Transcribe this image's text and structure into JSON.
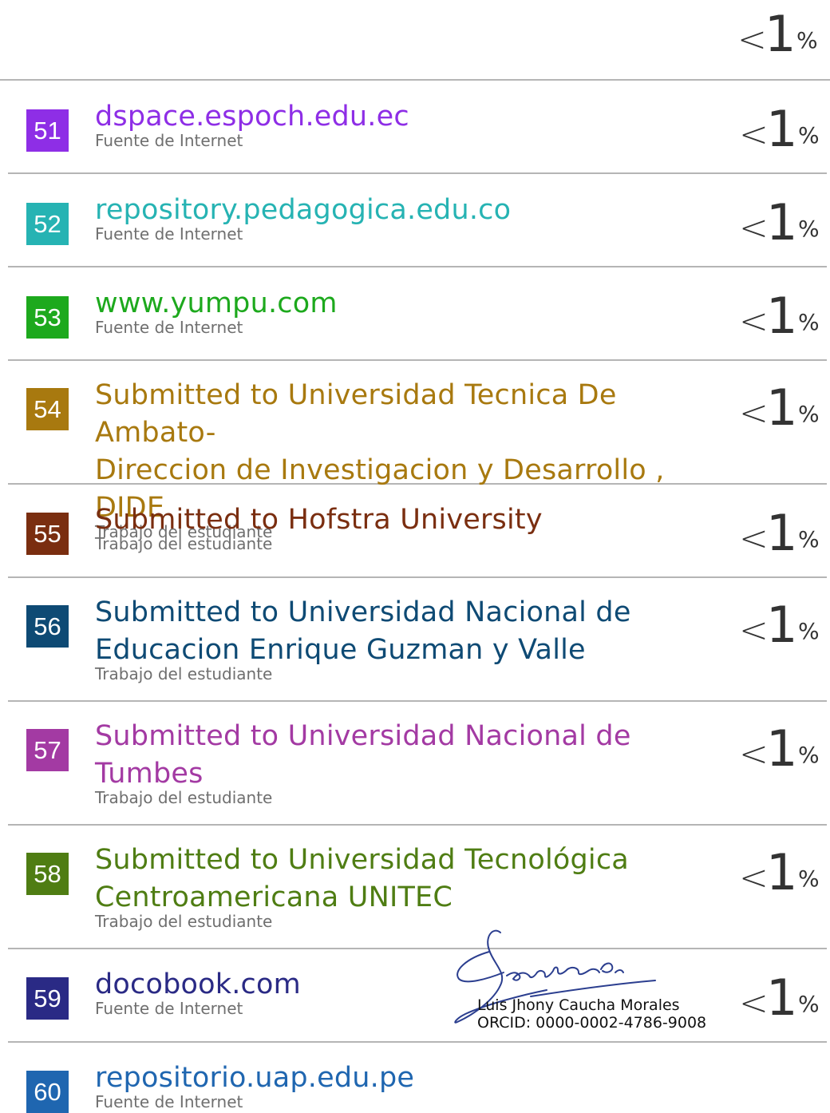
{
  "top_row": {
    "lt": "<",
    "one": "1",
    "percent": "%"
  },
  "sources": [
    {
      "index": "51",
      "title_lines": [
        "dspace.espoch.edu.ec"
      ],
      "type": "Fuente de Internet",
      "color": "#8e2ee6",
      "lt": "<",
      "one": "1",
      "percent": "%"
    },
    {
      "index": "52",
      "title_lines": [
        "repository.pedagogica.edu.co"
      ],
      "type": "Fuente de Internet",
      "color": "#26b3b3",
      "lt": "<",
      "one": "1",
      "percent": "%"
    },
    {
      "index": "53",
      "title_lines": [
        "www.yumpu.com"
      ],
      "type": "Fuente de Internet",
      "color": "#1da91d",
      "lt": "<",
      "one": "1",
      "percent": "%"
    },
    {
      "index": "54",
      "title_lines": [
        "Submitted to Universidad Tecnica De Ambato-",
        "Direccion de Investigacion y Desarrollo , DIDE"
      ],
      "type": "Trabajo del estudiante",
      "color": "#a8790f",
      "lt": "<",
      "one": "1",
      "percent": "%"
    },
    {
      "index": "55",
      "title_lines": [
        "Submitted to Hofstra University"
      ],
      "type": "Trabajo del estudiante",
      "color": "#7a2e10",
      "lt": "<",
      "one": "1",
      "percent": "%"
    },
    {
      "index": "56",
      "title_lines": [
        "Submitted to Universidad Nacional de",
        "Educacion Enrique Guzman y Valle"
      ],
      "type": "Trabajo del estudiante",
      "color": "#0e4a74",
      "lt": "<",
      "one": "1",
      "percent": "%"
    },
    {
      "index": "57",
      "title_lines": [
        "Submitted to Universidad Nacional de",
        "Tumbes"
      ],
      "type": "Trabajo del estudiante",
      "color": "#a33aa3",
      "lt": "<",
      "one": "1",
      "percent": "%"
    },
    {
      "index": "58",
      "title_lines": [
        "Submitted to Universidad Tecnológica",
        "Centroamericana UNITEC"
      ],
      "type": "Trabajo del estudiante",
      "color": "#4f7d13",
      "lt": "<",
      "one": "1",
      "percent": "%"
    },
    {
      "index": "59",
      "title_lines": [
        "docobook.com"
      ],
      "type": "Fuente de Internet",
      "color": "#2a2a85",
      "lt": "<",
      "one": "1",
      "percent": "%"
    },
    {
      "index": "60",
      "title_lines": [
        "repositorio.uap.edu.pe"
      ],
      "type": "Fuente de Internet",
      "color": "#1f66b0",
      "lt": "",
      "one": "",
      "percent": ""
    }
  ],
  "signature": {
    "name": "Luis Jhony Caucha Morales",
    "orcid": "ORCID: 0000-0002-4786-9008"
  }
}
